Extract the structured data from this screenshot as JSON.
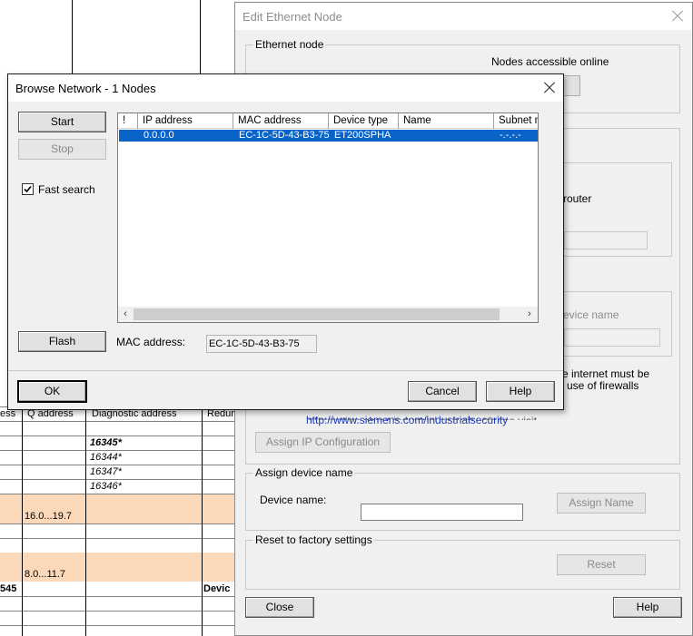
{
  "background_table": {
    "headers": {
      "col_a": "ess",
      "q_address": "Q address",
      "diagnostic_address": "Diagnostic address",
      "redundancy": "Redun"
    },
    "diag_values": [
      "16345*",
      "16344*",
      "16347*",
      "16346*"
    ],
    "q_values": [
      "16.0...19.7",
      "8.0...11.7"
    ],
    "row_text_a": "545",
    "row_text_device": "Devic"
  },
  "edit_node": {
    "title": "Edit Ethernet Node",
    "ethernet_node_group": "Ethernet node",
    "nodes_online_label": "Nodes accessible online",
    "router_label": "router",
    "device_name_partial": "evice name",
    "security_text_1": "e internet must be",
    "security_text_2": "use of firewalls",
    "security_text_3": "information about industrial security, please visit",
    "security_link": "http://www.siemens.com/industrialsecurity",
    "assign_ip_button": "Assign IP Configuration",
    "assign_device_name_group": "Assign device name",
    "device_name_label": "Device name:",
    "device_name_value": "",
    "assign_name_button": "Assign Name",
    "reset_group": "Reset to factory settings",
    "reset_button": "Reset",
    "close_button": "Close",
    "help_button": "Help"
  },
  "browse": {
    "title": "Browse Network - 1 Nodes",
    "start_button": "Start",
    "stop_button": "Stop",
    "fast_search_label": "Fast search",
    "fast_search_checked": true,
    "flash_button": "Flash",
    "mac_label": "MAC address:",
    "mac_value": "EC-1C-5D-43-B3-75",
    "ok_button": "OK",
    "cancel_button": "Cancel",
    "help_button": "Help",
    "columns": [
      "!",
      "IP address",
      "MAC address",
      "Device type",
      "Name",
      "Subnet m"
    ],
    "rows": [
      {
        "status": "",
        "ip": "0.0.0.0",
        "mac": "EC-1C-5D-43-B3-75",
        "device_type": "ET200SPHA",
        "name": "",
        "subnet": "-.-.-.-"
      }
    ],
    "selection_color": "#0a64c8"
  }
}
